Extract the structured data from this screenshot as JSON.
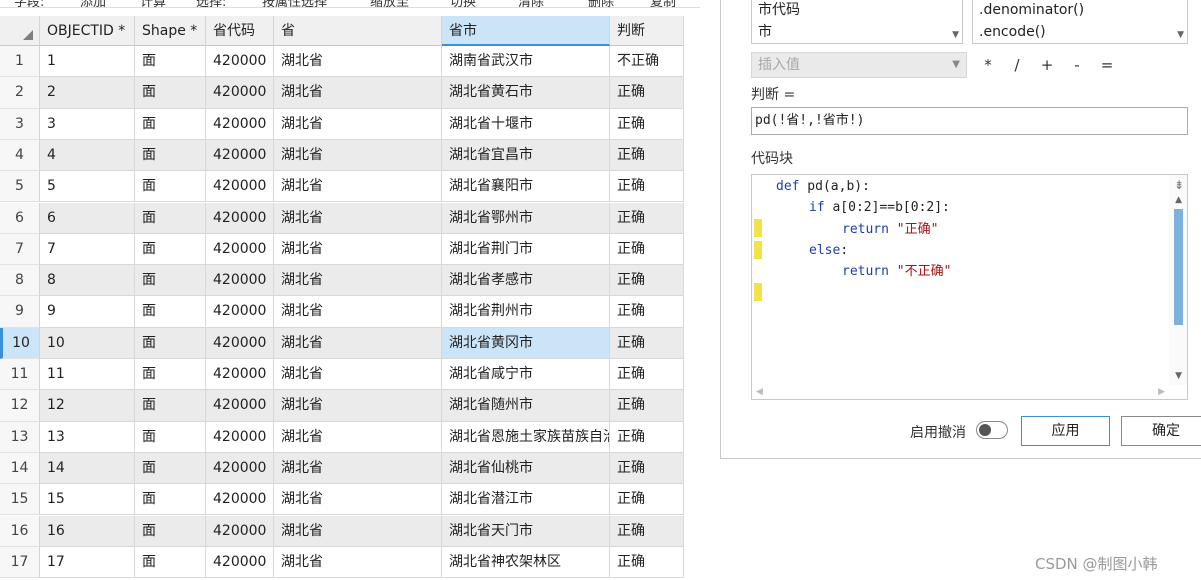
{
  "toolbar": {
    "items": [
      "字段:",
      "添加",
      "计算",
      "选择:",
      "按属性选择",
      "缩放至",
      "切换",
      "清除",
      "删除",
      "复制"
    ]
  },
  "table": {
    "headers": [
      "OBJECTID *",
      "Shape *",
      "省代码",
      "省",
      "省市",
      "判断"
    ],
    "selected_column": 4,
    "selected_row": 10,
    "rows": [
      {
        "n": "1",
        "cells": [
          "1",
          "面",
          "420000",
          "湖北省",
          "湖南省武汉市",
          "不正确"
        ]
      },
      {
        "n": "2",
        "cells": [
          "2",
          "面",
          "420000",
          "湖北省",
          "湖北省黄石市",
          "正确"
        ]
      },
      {
        "n": "3",
        "cells": [
          "3",
          "面",
          "420000",
          "湖北省",
          "湖北省十堰市",
          "正确"
        ]
      },
      {
        "n": "4",
        "cells": [
          "4",
          "面",
          "420000",
          "湖北省",
          "湖北省宜昌市",
          "正确"
        ]
      },
      {
        "n": "5",
        "cells": [
          "5",
          "面",
          "420000",
          "湖北省",
          "湖北省襄阳市",
          "正确"
        ]
      },
      {
        "n": "6",
        "cells": [
          "6",
          "面",
          "420000",
          "湖北省",
          "湖北省鄂州市",
          "正确"
        ]
      },
      {
        "n": "7",
        "cells": [
          "7",
          "面",
          "420000",
          "湖北省",
          "湖北省荆门市",
          "正确"
        ]
      },
      {
        "n": "8",
        "cells": [
          "8",
          "面",
          "420000",
          "湖北省",
          "湖北省孝感市",
          "正确"
        ]
      },
      {
        "n": "9",
        "cells": [
          "9",
          "面",
          "420000",
          "湖北省",
          "湖北省荆州市",
          "正确"
        ]
      },
      {
        "n": "10",
        "cells": [
          "10",
          "面",
          "420000",
          "湖北省",
          "湖北省黄冈市",
          "正确"
        ]
      },
      {
        "n": "11",
        "cells": [
          "11",
          "面",
          "420000",
          "湖北省",
          "湖北省咸宁市",
          "正确"
        ]
      },
      {
        "n": "12",
        "cells": [
          "12",
          "面",
          "420000",
          "湖北省",
          "湖北省随州市",
          "正确"
        ]
      },
      {
        "n": "13",
        "cells": [
          "13",
          "面",
          "420000",
          "湖北省",
          "湖北省恩施土家族苗族自治州",
          "正确"
        ]
      },
      {
        "n": "14",
        "cells": [
          "14",
          "面",
          "420000",
          "湖北省",
          "湖北省仙桃市",
          "正确"
        ]
      },
      {
        "n": "15",
        "cells": [
          "15",
          "面",
          "420000",
          "湖北省",
          "湖北省潜江市",
          "正确"
        ]
      },
      {
        "n": "16",
        "cells": [
          "16",
          "面",
          "420000",
          "湖北省",
          "湖北省天门市",
          "正确"
        ]
      },
      {
        "n": "17",
        "cells": [
          "17",
          "面",
          "420000",
          "湖北省",
          "湖北省神农架林区",
          "正确"
        ]
      }
    ]
  },
  "dialog": {
    "fields_list": [
      "市代码",
      "市"
    ],
    "helpers_list": [
      ".denominator()",
      ".encode()"
    ],
    "insert_value_placeholder": "插入值",
    "operators": [
      "*",
      "/",
      "+",
      "-",
      "="
    ],
    "expression_label": "判断 =",
    "expression": "pd(!省!,!省市!)",
    "code_block_label": "代码块",
    "code_lines": [
      {
        "kw": "def",
        "rest": " pd(a,b):",
        "indent": 0,
        "mark": false
      },
      {
        "kw": "if",
        "rest": " a[0:2]==b[0:2]:",
        "indent": 1,
        "mark": true
      },
      {
        "kw": "return",
        "rest": " \"正确\"",
        "indent": 2,
        "mark": true
      },
      {
        "kw": "else",
        "rest": ":",
        "indent": 1,
        "mark": false
      },
      {
        "kw": "return",
        "rest": " \"不正确\"",
        "indent": 2,
        "mark": true
      }
    ],
    "enable_undo_label": "启用撤消",
    "enable_undo_on": false,
    "apply_label": "应用",
    "ok_label": "确定"
  },
  "watermark": "CSDN @制图小韩",
  "colors": {
    "selection": "#cce4f7",
    "accent": "#3c8fd6",
    "alt_row": "#ebebeb",
    "keyword": "#1f3db0",
    "string": "#a31515",
    "change_marker": "#f3e24a"
  }
}
